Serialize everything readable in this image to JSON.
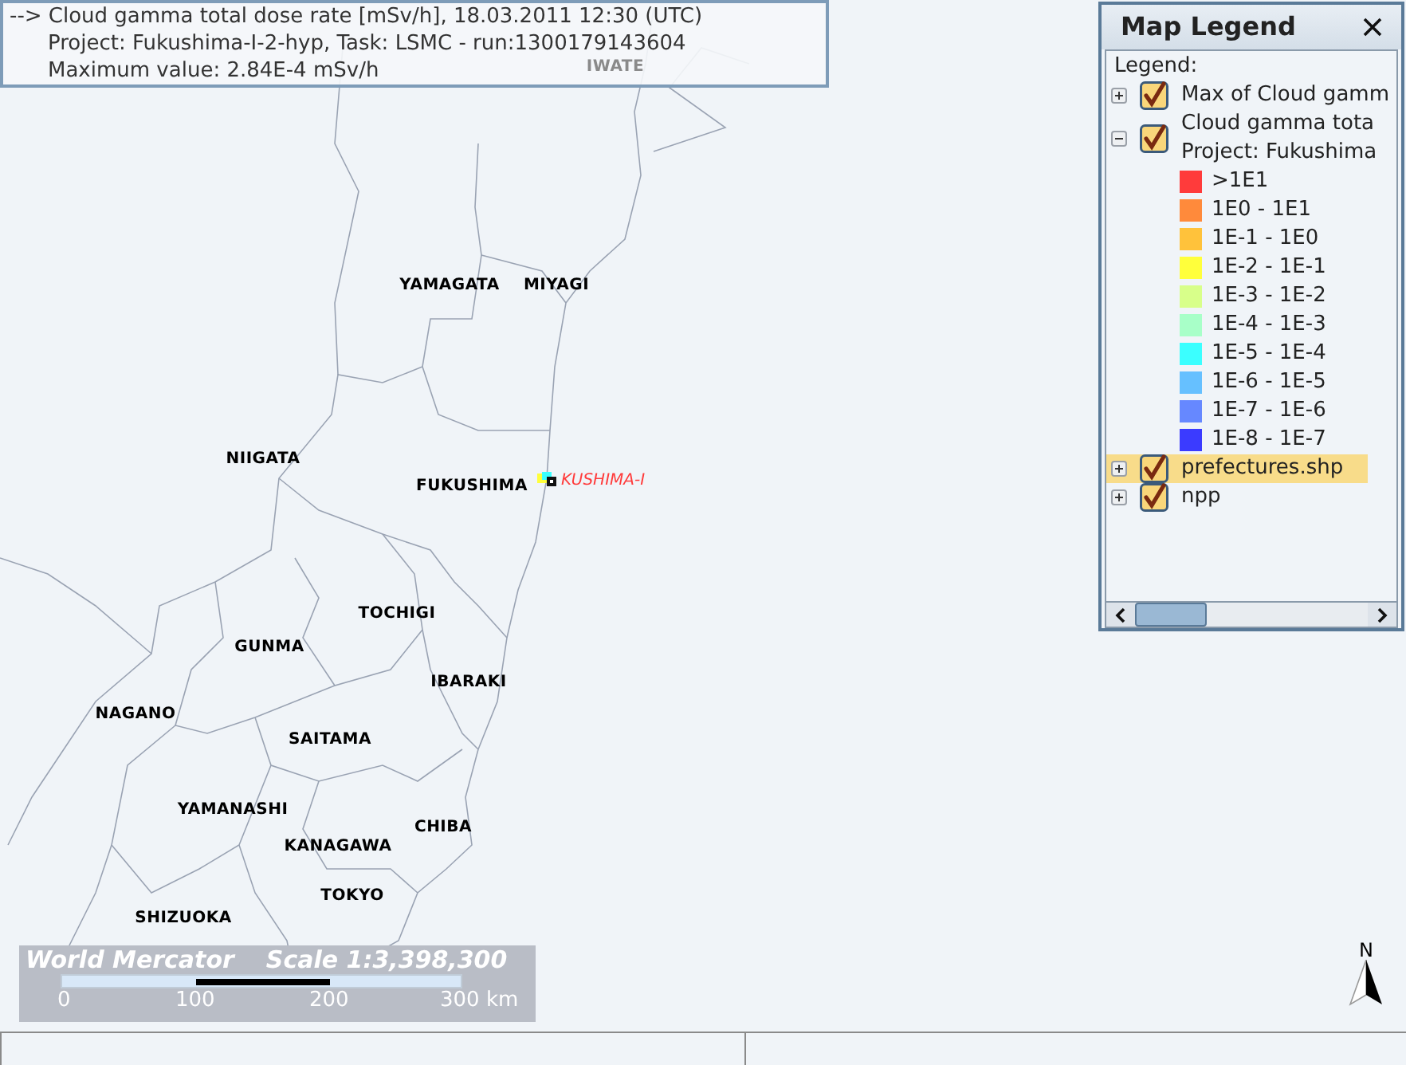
{
  "info_box": {
    "lines": [
      "--> Cloud gamma total dose rate [mSv/h], 18.03.2011 12:30 (UTC)",
      "Project: Fukushima-I-2-hyp, Task: LSMC - run:1300179143604",
      "Maximum value: 2.84E-4 mSv/h"
    ]
  },
  "map": {
    "labels": [
      {
        "text": "IWATE",
        "kind": "faded"
      },
      {
        "text": "YAMAGATA",
        "kind": "prefecture"
      },
      {
        "text": "MIYAGI",
        "kind": "prefecture"
      },
      {
        "text": "NIIGATA",
        "kind": "prefecture"
      },
      {
        "text": "FUKUSHIMA",
        "kind": "prefecture"
      },
      {
        "text": "TOCHIGI",
        "kind": "prefecture"
      },
      {
        "text": "GUNMA",
        "kind": "prefecture"
      },
      {
        "text": "IBARAKI",
        "kind": "prefecture"
      },
      {
        "text": "NAGANO",
        "kind": "prefecture"
      },
      {
        "text": "SAITAMA",
        "kind": "prefecture"
      },
      {
        "text": "YAMANASHI",
        "kind": "prefecture"
      },
      {
        "text": "CHIBA",
        "kind": "prefecture"
      },
      {
        "text": "KANAGAWA",
        "kind": "prefecture"
      },
      {
        "text": "TOKYO",
        "kind": "prefecture"
      },
      {
        "text": "SHIZUOKA",
        "kind": "prefecture"
      }
    ],
    "plant": {
      "label": "KUSHIMA-I"
    },
    "scale": {
      "projection": "World Mercator",
      "scale": "Scale 1:3,398,300",
      "ticks": [
        "0",
        "100",
        "200",
        "300 km"
      ]
    },
    "north": "N"
  },
  "legend": {
    "title": "Map Legend",
    "heading": "Legend:",
    "layers": [
      {
        "name": "Max of Cloud gamm",
        "checked": true,
        "expanded": false,
        "selected": false
      },
      {
        "name": "Cloud gamma tota",
        "subtitle": "Project: Fukushima",
        "checked": true,
        "expanded": true,
        "selected": false,
        "classes": [
          {
            "label": ">1E1",
            "color": "#ff3b3b"
          },
          {
            "label": "1E0 - 1E1",
            "color": "#ff8a3b"
          },
          {
            "label": "1E-1 - 1E0",
            "color": "#ffc23b"
          },
          {
            "label": "1E-2 - 1E-1",
            "color": "#ffff3b"
          },
          {
            "label": "1E-3 - 1E-2",
            "color": "#d8ff8a"
          },
          {
            "label": "1E-4 - 1E-3",
            "color": "#a8ffc8"
          },
          {
            "label": "1E-5 - 1E-4",
            "color": "#3bffff"
          },
          {
            "label": "1E-6 - 1E-5",
            "color": "#66c0ff"
          },
          {
            "label": "1E-7 - 1E-6",
            "color": "#6688ff"
          },
          {
            "label": "1E-8 - 1E-7",
            "color": "#3b3bff"
          }
        ]
      },
      {
        "name": "prefectures.shp",
        "checked": true,
        "expanded": false,
        "selected": true
      },
      {
        "name": "npp",
        "checked": true,
        "expanded": false,
        "selected": false
      }
    ]
  }
}
